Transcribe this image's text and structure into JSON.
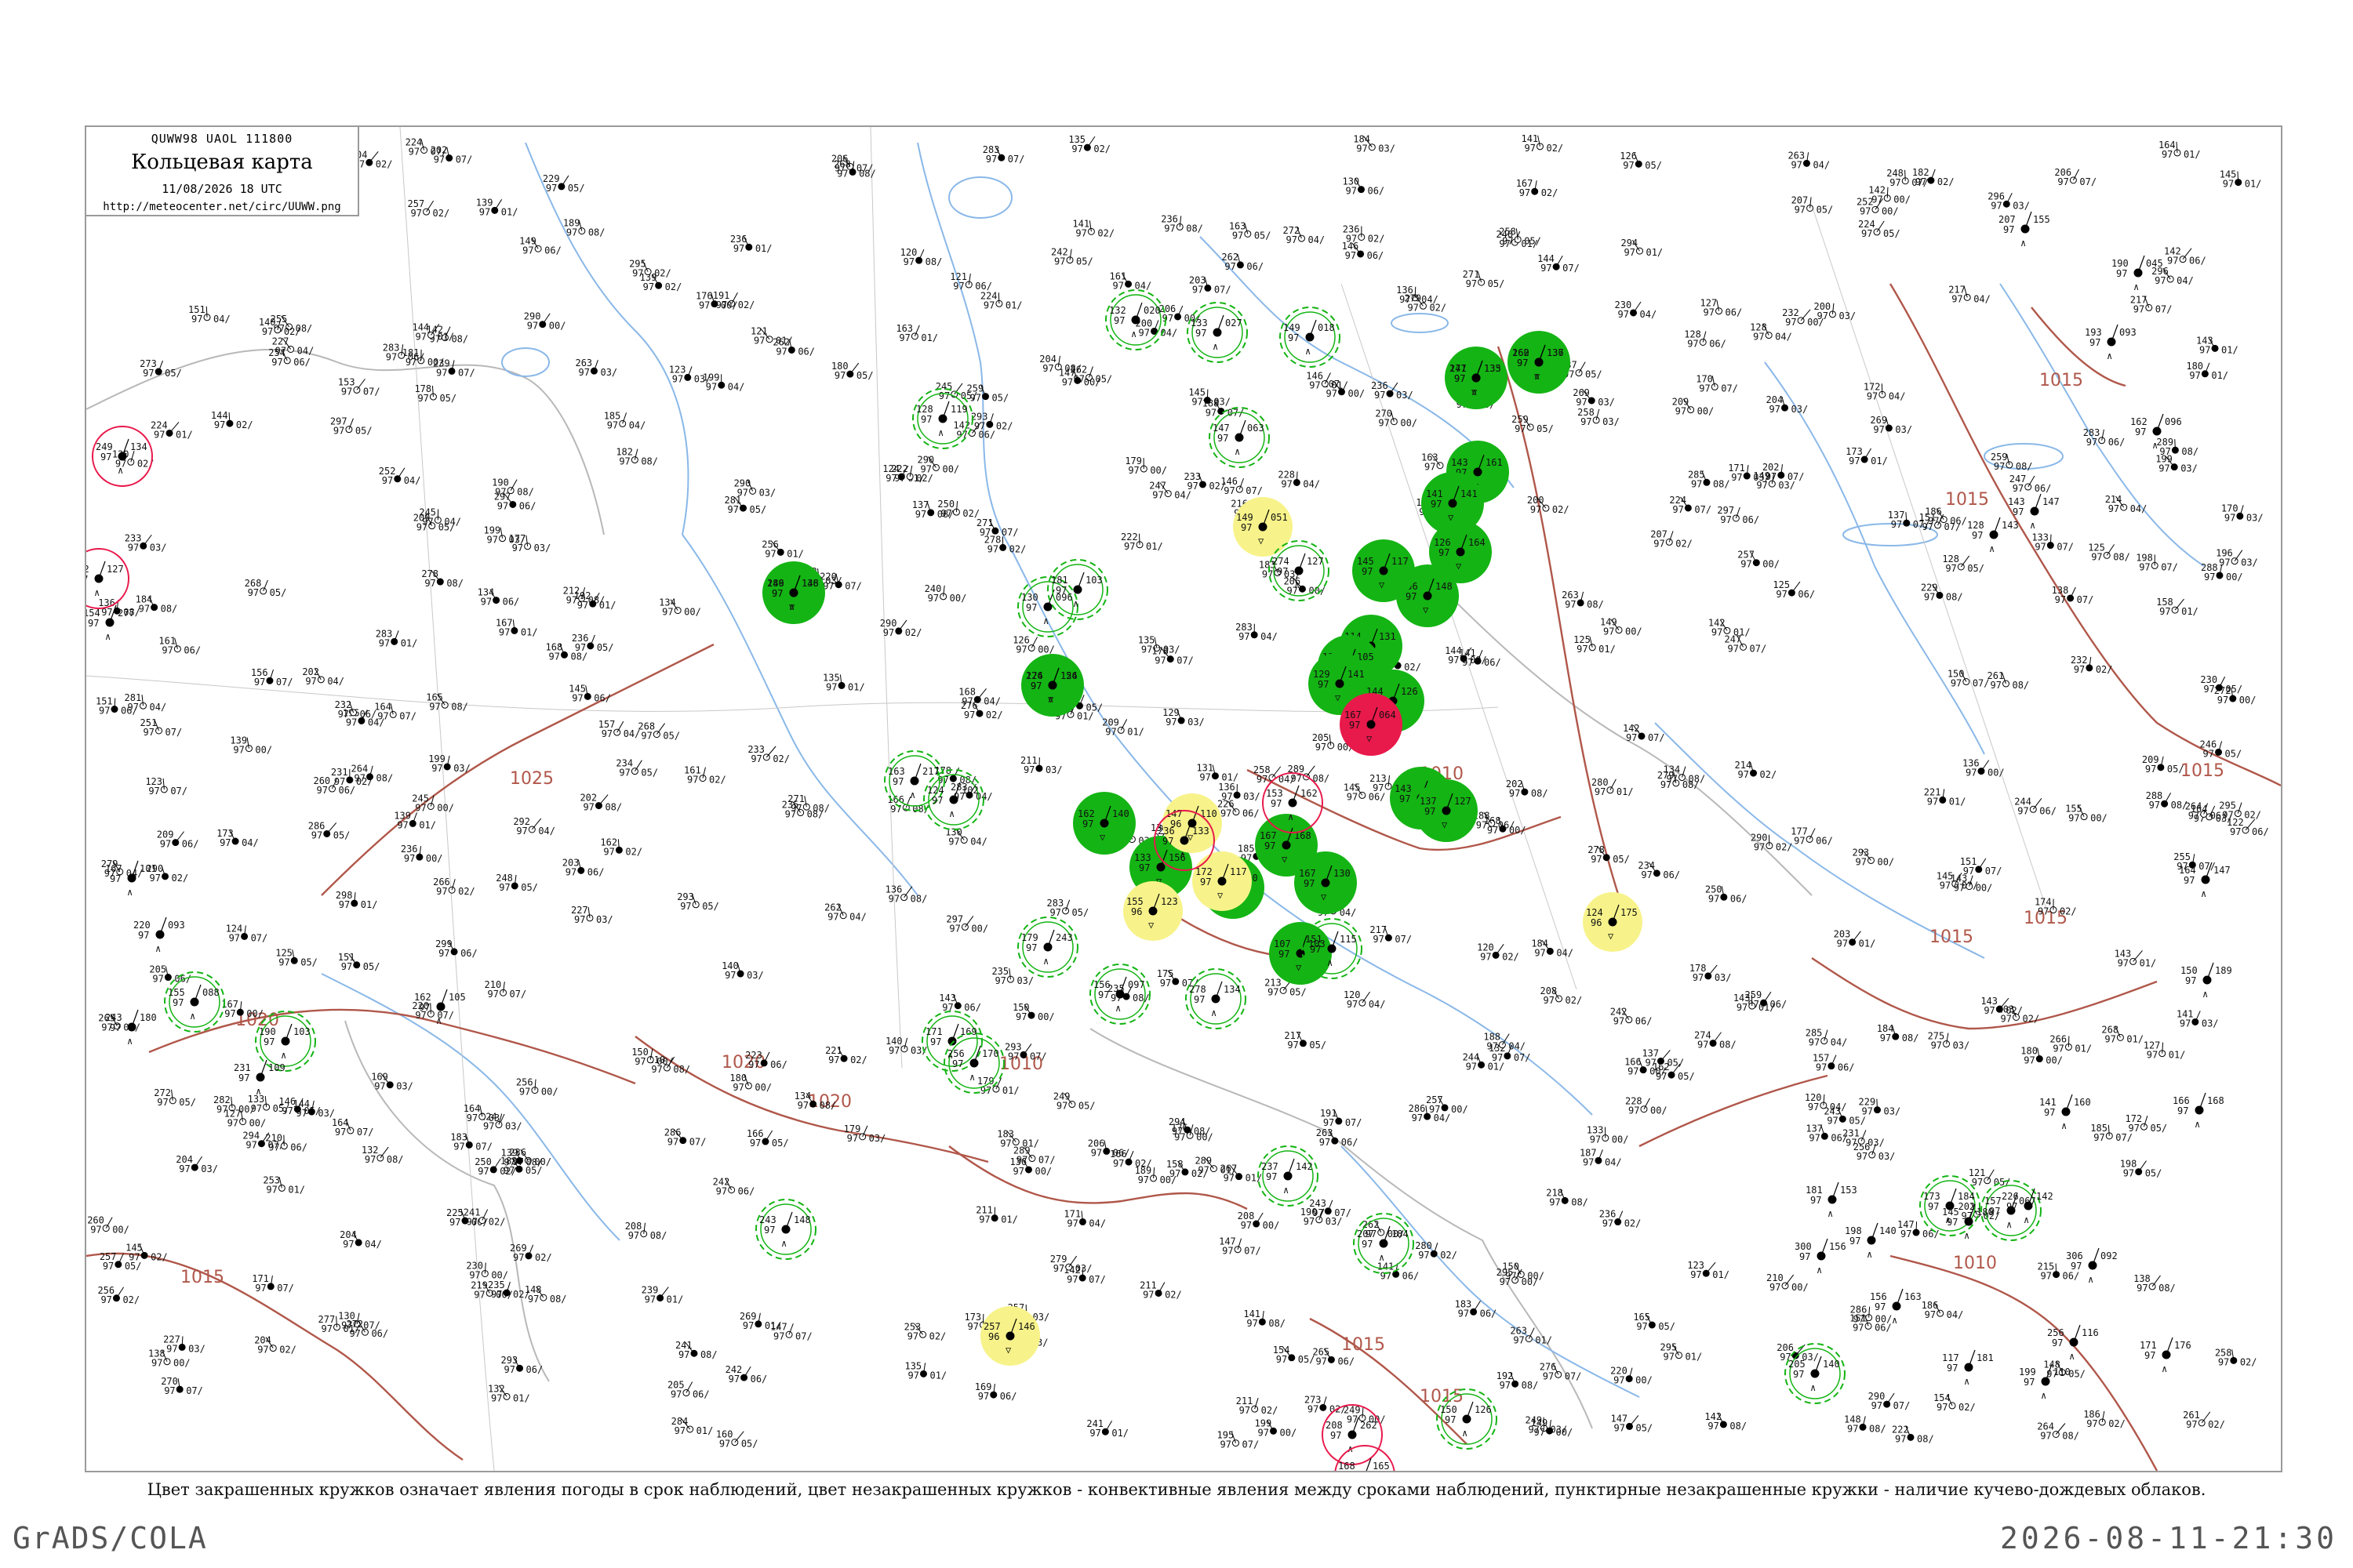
{
  "header": {
    "code": "QUWW98 UAOL 111800",
    "title": "Кольцевая карта",
    "date": "11/08/2026 18 UTC",
    "url": "http://meteocenter.net/circ/UUWW.png"
  },
  "caption": "Цвет закрашенных кружков означает явления погоды в срок наблюдений, цвет незакрашенных кружков - конвективные явления между сроками наблюдений, пунктирные незакрашенные кружки - наличие кучево-дождевых облаков.",
  "footer": {
    "left": "GrADS/COLA",
    "right": "2026-08-11-21:30"
  },
  "colors": {
    "green": "#14b414",
    "yellow": "#f7f38a",
    "red": "#e8194b",
    "isobar": "#b0574a",
    "river": "#8ab8e8",
    "border": "#b8b8b8"
  },
  "isobars": [
    {
      "label": "1025"
    },
    {
      "label": "1020"
    },
    {
      "label": "1020"
    },
    {
      "label": "1015"
    },
    {
      "label": "1015"
    },
    {
      "label": "1015"
    },
    {
      "label": "1015"
    },
    {
      "label": "1015"
    },
    {
      "label": "1010"
    },
    {
      "label": "1010"
    },
    {
      "label": "1010"
    },
    {
      "label": "1015"
    },
    {
      "label": "1015"
    },
    {
      "label": "1020"
    },
    {
      "label": "1015"
    }
  ],
  "stations": [
    {
      "type": "green-filled",
      "t": "149",
      "d": "138",
      "p": "97"
    },
    {
      "type": "green-filled",
      "t": "124",
      "d": "124",
      "p": "97"
    },
    {
      "type": "green-filled",
      "t": "141",
      "d": "133",
      "p": "97"
    },
    {
      "type": "green-filled",
      "t": "162",
      "d": "136",
      "p": "97"
    },
    {
      "type": "green-filled",
      "t": "143",
      "d": "161",
      "p": "97"
    },
    {
      "type": "green-filled",
      "t": "141",
      "d": "141",
      "p": "97"
    },
    {
      "type": "green-filled",
      "t": "156",
      "d": "148",
      "p": "97"
    },
    {
      "type": "green-filled",
      "t": "126",
      "d": "164",
      "p": "97"
    },
    {
      "type": "green-filled",
      "t": "145",
      "d": "117",
      "p": "97"
    },
    {
      "type": "green-filled",
      "t": "114",
      "d": "131",
      "p": "97"
    },
    {
      "type": "green-filled",
      "t": "151",
      "d": "105",
      "p": "97"
    },
    {
      "type": "green-filled",
      "t": "129",
      "d": "141",
      "p": "97"
    },
    {
      "type": "green-filled",
      "t": "144",
      "d": "126",
      "p": "97"
    },
    {
      "type": "green-filled",
      "t": "143",
      "d": "136",
      "p": "97"
    },
    {
      "type": "green-filled",
      "t": "137",
      "d": "127",
      "p": "97"
    },
    {
      "type": "green-filled",
      "t": "162",
      "d": "140",
      "p": "97"
    },
    {
      "type": "green-filled",
      "t": "133",
      "d": "156",
      "p": "97"
    },
    {
      "type": "green-filled",
      "t": "167",
      "d": "160",
      "p": "97"
    },
    {
      "type": "green-filled",
      "t": "167",
      "d": "168",
      "p": "97"
    },
    {
      "type": "green-filled",
      "t": "167",
      "d": "130",
      "p": "97"
    },
    {
      "type": "green-filled",
      "t": "107",
      "d": "103",
      "p": "97"
    },
    {
      "type": "red-filled",
      "t": "167",
      "d": "064",
      "p": "97"
    },
    {
      "type": "yellow-filled",
      "t": "149",
      "d": "051",
      "p": "97"
    },
    {
      "type": "yellow-filled",
      "t": "147",
      "d": "110",
      "p": "96"
    },
    {
      "type": "yellow-filled",
      "t": "172",
      "d": "117",
      "p": "97"
    },
    {
      "type": "yellow-filled",
      "t": "155",
      "d": "123",
      "p": "96"
    },
    {
      "type": "yellow-filled",
      "t": "124",
      "d": "175",
      "p": "96"
    },
    {
      "type": "yellow-filled",
      "t": "257",
      "d": "146",
      "p": "96"
    },
    {
      "type": "green-ring",
      "t": "132",
      "d": "020",
      "p": "97"
    },
    {
      "type": "green-ring",
      "t": "133",
      "d": "027",
      "p": "97"
    },
    {
      "type": "green-ring",
      "t": "149",
      "d": "018",
      "p": "97"
    },
    {
      "type": "green-ring",
      "t": "147",
      "d": "063",
      "p": "97"
    },
    {
      "type": "green-ring",
      "t": "130",
      "d": "096",
      "p": "97"
    },
    {
      "type": "green-ring",
      "t": "181",
      "d": "103",
      "p": "97"
    },
    {
      "type": "green-ring",
      "t": "128",
      "d": "119",
      "p": "97"
    },
    {
      "type": "green-ring",
      "t": "163",
      "d": "217",
      "p": "97"
    },
    {
      "type": "green-ring",
      "t": "124",
      "d": "102",
      "p": "97"
    },
    {
      "type": "green-ring",
      "t": "179",
      "d": "243",
      "p": "97"
    },
    {
      "type": "green-ring",
      "t": "171",
      "d": "169",
      "p": "97"
    },
    {
      "type": "green-ring",
      "t": "243",
      "d": "148",
      "p": "97"
    },
    {
      "type": "green-ring",
      "t": "256",
      "d": "170",
      "p": "97"
    },
    {
      "type": "green-ring",
      "t": "207",
      "d": "184",
      "p": "97"
    },
    {
      "type": "green-ring",
      "t": "156",
      "d": "097",
      "p": "97"
    },
    {
      "type": "green-ring",
      "t": "237",
      "d": "142",
      "p": "97"
    },
    {
      "type": "green-ring",
      "t": "151",
      "d": "115",
      "p": "97"
    },
    {
      "type": "green-ring",
      "t": "150",
      "d": "126",
      "p": "97"
    },
    {
      "type": "green-ring",
      "t": "173",
      "d": "184",
      "p": "97"
    },
    {
      "type": "green-ring",
      "t": "157",
      "d": "067",
      "p": "97"
    },
    {
      "type": "green-ring",
      "t": "205",
      "d": "140",
      "p": "97"
    },
    {
      "type": "green-ring",
      "t": "274",
      "d": "127",
      "p": "97"
    },
    {
      "type": "green-ring",
      "t": "278",
      "d": "134",
      "p": "97"
    },
    {
      "type": "green-ring",
      "t": "155",
      "d": "088",
      "p": "97"
    },
    {
      "type": "green-ring",
      "t": "190",
      "d": "103",
      "p": "97"
    },
    {
      "type": "red-ring",
      "t": "153",
      "d": "162",
      "p": "97"
    },
    {
      "type": "red-ring",
      "t": "208",
      "d": "262",
      "p": "97"
    },
    {
      "type": "red-ring",
      "t": "168",
      "d": "165",
      "p": "97"
    },
    {
      "type": "red-ring",
      "t": "236",
      "d": "133",
      "p": "97"
    },
    {
      "type": "red-ring",
      "t": "249",
      "d": "134",
      "p": "97"
    },
    {
      "type": "red-ring",
      "t": "162",
      "d": "127",
      "p": "97"
    },
    {
      "type": "plain",
      "t": "154",
      "d": "277",
      "p": "97"
    },
    {
      "type": "plain",
      "t": "167",
      "d": "101",
      "p": "97"
    },
    {
      "type": "plain",
      "t": "220",
      "d": "093",
      "p": "97"
    },
    {
      "type": "plain",
      "t": "243",
      "d": "180",
      "p": "97"
    },
    {
      "type": "plain",
      "t": "231",
      "d": "109",
      "p": "97"
    },
    {
      "type": "plain",
      "t": "162",
      "d": "105",
      "p": "97"
    },
    {
      "type": "plain",
      "t": "207",
      "d": "155",
      "p": "97"
    },
    {
      "type": "plain",
      "t": "190",
      "d": "045",
      "p": "97"
    },
    {
      "type": "plain",
      "t": "193",
      "d": "093",
      "p": "97"
    },
    {
      "type": "plain",
      "t": "162",
      "d": "096",
      "p": "97"
    },
    {
      "type": "plain",
      "t": "143",
      "d": "147",
      "p": "97"
    },
    {
      "type": "plain",
      "t": "128",
      "d": "143",
      "p": "97"
    },
    {
      "type": "plain",
      "t": "164",
      "d": "147",
      "p": "97"
    },
    {
      "type": "plain",
      "t": "150",
      "d": "189",
      "p": "97"
    },
    {
      "type": "plain",
      "t": "141",
      "d": "160",
      "p": "97"
    },
    {
      "type": "plain",
      "t": "166",
      "d": "168",
      "p": "97"
    },
    {
      "type": "plain",
      "t": "171",
      "d": "176",
      "p": "97"
    },
    {
      "type": "plain",
      "t": "145",
      "d": "180",
      "p": "97"
    },
    {
      "type": "plain",
      "t": "181",
      "d": "153",
      "p": "97"
    },
    {
      "type": "plain",
      "t": "156",
      "d": "163",
      "p": "97"
    },
    {
      "type": "plain",
      "t": "117",
      "d": "181",
      "p": "97"
    },
    {
      "type": "plain",
      "t": "198",
      "d": "140",
      "p": "97"
    },
    {
      "type": "plain",
      "t": "226",
      "d": "142",
      "p": "97"
    },
    {
      "type": "plain",
      "t": "306",
      "d": "092",
      "p": "97"
    },
    {
      "type": "plain",
      "t": "256",
      "d": "116",
      "p": "97"
    },
    {
      "type": "plain",
      "t": "199",
      "d": "110",
      "p": "97"
    },
    {
      "type": "plain",
      "t": "300",
      "d": "156",
      "p": "97"
    },
    {
      "type": "plain",
      "t": "286",
      "d": "146",
      "p": "97"
    },
    {
      "type": "plain",
      "t": "276",
      "d": "156",
      "p": "97"
    },
    {
      "type": "plain",
      "t": "277",
      "d": "135",
      "p": "97"
    },
    {
      "type": "plain",
      "t": "260",
      "d": "137",
      "p": "97"
    }
  ]
}
